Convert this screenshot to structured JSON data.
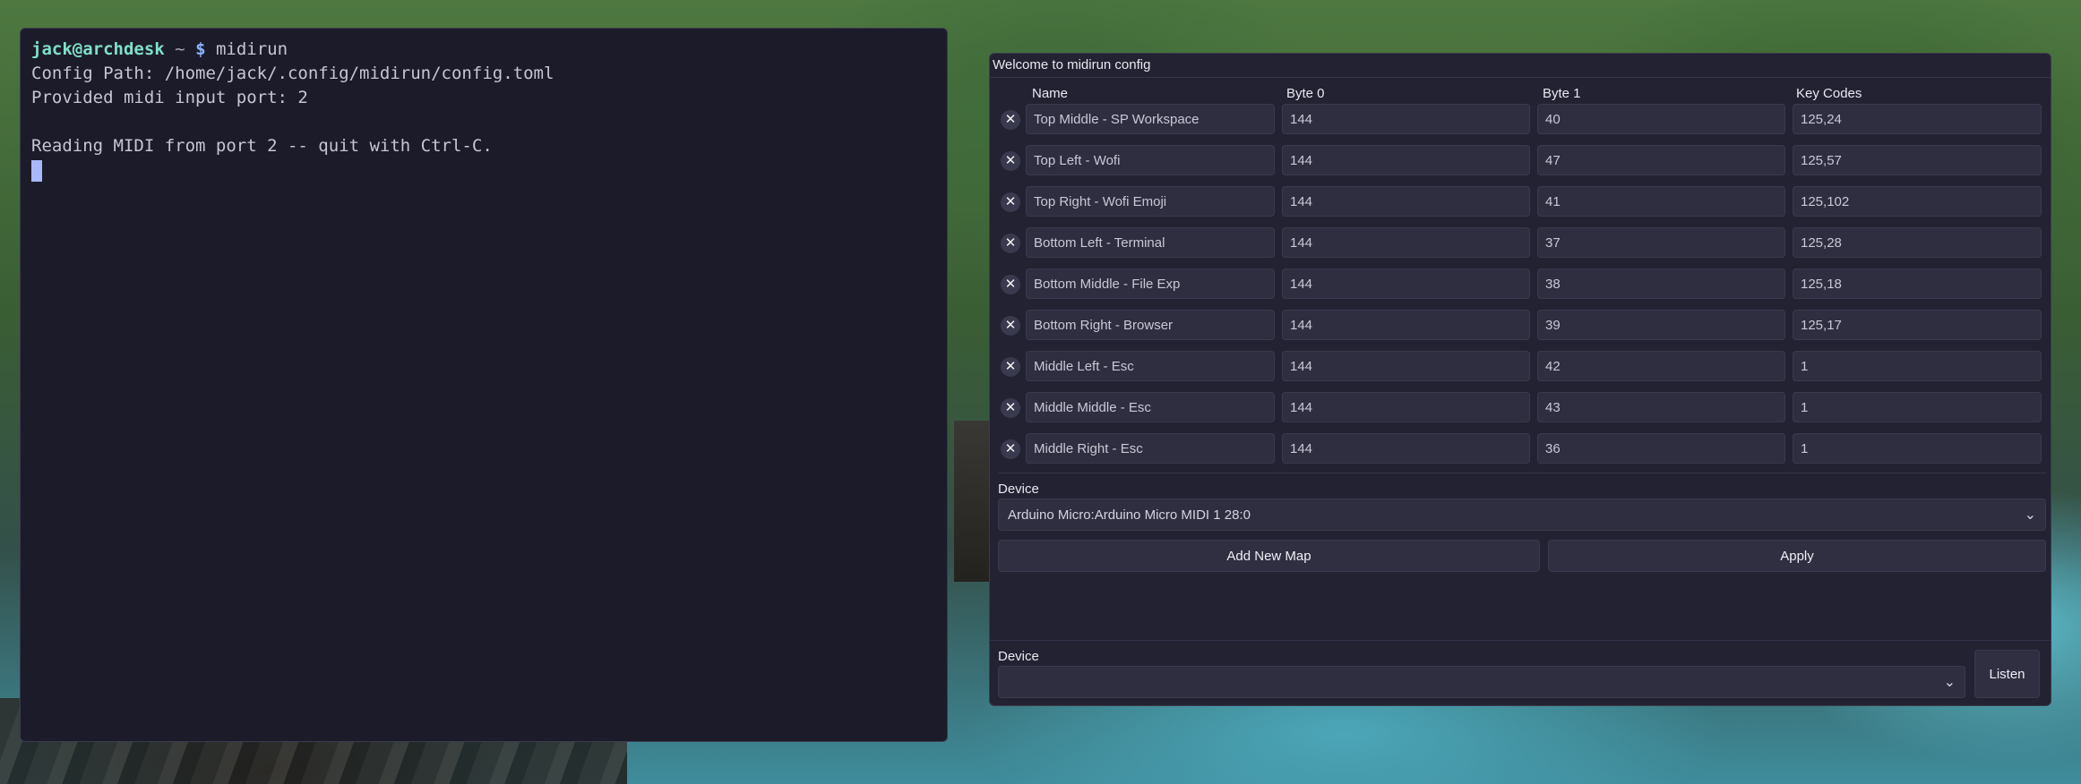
{
  "terminal": {
    "prompt_user": "jack@archdesk",
    "prompt_path": "~",
    "prompt_symbol": "$",
    "command": "midirun",
    "lines": [
      "Config Path: /home/jack/.config/midirun/config.toml",
      "Provided midi input port: 2",
      "",
      "Reading MIDI from port 2 -- quit with Ctrl-C."
    ]
  },
  "config": {
    "title": "Welcome to midirun config",
    "columns": [
      "Name",
      "Byte 0",
      "Byte 1",
      "Key Codes"
    ],
    "delete_icon": "close-icon",
    "rows": [
      {
        "name": "Top Middle - SP Workspace",
        "byte0": "144",
        "byte1": "40",
        "keys": "125,24"
      },
      {
        "name": "Top Left - Wofi",
        "byte0": "144",
        "byte1": "47",
        "keys": "125,57"
      },
      {
        "name": "Top Right - Wofi Emoji",
        "byte0": "144",
        "byte1": "41",
        "keys": "125,102"
      },
      {
        "name": "Bottom Left - Terminal",
        "byte0": "144",
        "byte1": "37",
        "keys": "125,28"
      },
      {
        "name": "Bottom Middle - File Exp",
        "byte0": "144",
        "byte1": "38",
        "keys": "125,18"
      },
      {
        "name": " Bottom Right - Browser",
        "byte0": "144",
        "byte1": "39",
        "keys": "125,17"
      },
      {
        "name": "Middle Left - Esc",
        "byte0": "144",
        "byte1": "42",
        "keys": "1"
      },
      {
        "name": "Middle Middle - Esc",
        "byte0": "144",
        "byte1": "43",
        "keys": "1"
      },
      {
        "name": "Middle Right - Esc",
        "byte0": "144",
        "byte1": "36",
        "keys": "1"
      }
    ],
    "device_label": "Device",
    "device_value": "Arduino Micro:Arduino Micro MIDI 1 28:0",
    "add_label": "Add New Map",
    "apply_label": "Apply",
    "listen_device_label": "Device",
    "listen_device_value": "",
    "listen_label": "Listen"
  },
  "colors": {
    "terminal_bg": "#1c1b29",
    "window_bg": "#232232",
    "field_bg": "#2f2e40",
    "prompt_user": "#7ee0c8",
    "prompt_symbol": "#8ab4ff"
  }
}
